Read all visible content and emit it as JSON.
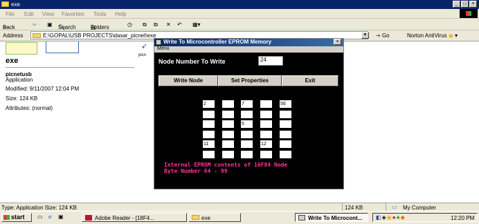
{
  "explorer": {
    "title": "exe",
    "menu": [
      "File",
      "Edit",
      "View",
      "Favorites",
      "Tools",
      "Help"
    ],
    "toolbar": {
      "back": "Back",
      "search": "Search",
      "folders": "Folders"
    },
    "address_label": "Address",
    "address_value": "E:\\GOPAL\\USB PROJECTS\\dasar_picnet\\exe",
    "go_label": "Go",
    "norton_label": "Norton AntiVirus",
    "left_pane": {
      "folder_title": "exe",
      "file_name": "picnetusb",
      "file_type": "Application",
      "modified": "Modified: 9/11/2007 12:04 PM",
      "size": "Size: 124 KB",
      "attributes": "Attributes: (normal)"
    },
    "partial_file_label": "picn"
  },
  "status_bar": {
    "left": "Type: Application Size: 124 KB",
    "size": "124 KB",
    "zone": "My Computer"
  },
  "taskbar": {
    "start": "start",
    "buttons": [
      "Adobe Reader - [18F4...",
      "exe",
      "Write To Microcont..."
    ],
    "clock": "12:20 PM"
  },
  "dialog": {
    "title": "Write To Microcontroller EPROM Memory",
    "menu": "Menu",
    "node_label": "Node Number To Write",
    "node_value": "24",
    "buttons": [
      "Write Node",
      "Set Properties",
      "Exit"
    ],
    "grid": [
      [
        "2",
        "",
        "7",
        "",
        "56"
      ],
      [
        "",
        "",
        "",
        "",
        ""
      ],
      [
        "",
        "",
        "5",
        "",
        ""
      ],
      [
        "",
        "",
        "",
        "",
        ""
      ],
      [
        "11",
        "",
        "",
        "12",
        ""
      ],
      [
        "",
        "",
        "",
        "",
        ""
      ]
    ],
    "info_line1": "Internal EPROM contents of 16F84 Node",
    "info_line2": "Byte Number 64 - 99"
  },
  "colors": {
    "titlebar": "#0a246a",
    "dialog_bg": "#000000",
    "info_text": "#ff3399",
    "chrome": "#ece9d8"
  }
}
